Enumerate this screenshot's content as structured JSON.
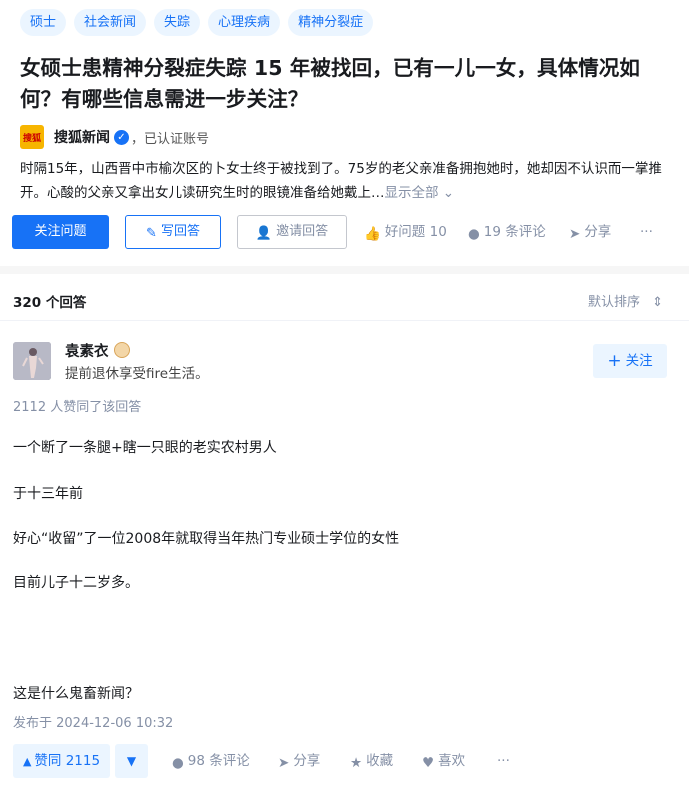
{
  "tags": [
    "硕士",
    "社会新闻",
    "失踪",
    "心理疾病",
    "精神分裂症"
  ],
  "question": {
    "title": "女硕士患精神分裂症失踪 15 年被找回，已有一儿一女，具体情况如何？有哪些信息需进一步关注？",
    "source_logo": "搜狐",
    "source_name": "搜狐新闻",
    "verified_text": "，已认证账号",
    "description": "时隔15年，山西晋中市榆次区的卜女士终于被找到了。75岁的老父亲准备拥抱她时，她却因不认识而一掌推开。心酸的父亲又拿出女儿读研究生时的眼镜准备给她戴上…",
    "show_all": "显示全部",
    "actions": {
      "follow": "关注问题",
      "write": "写回答",
      "invite": "邀请回答",
      "good_question": "好问题 10",
      "comments": "19 条评论",
      "share": "分享",
      "more": "···"
    }
  },
  "answers": {
    "count_label": "320 个回答",
    "sort_label": "默认排序",
    "item": {
      "author_name": "袁素衣",
      "author_bio": "提前退休享受fire生活。",
      "follow_label": "关注",
      "likes_text": "2112 人赞同了该回答",
      "paragraphs": [
        "一个断了一条腿+瞎一只眼的老实农村男人",
        "于十三年前",
        "好心“收留”了一位2008年就取得当年热门专业硕士学位的女性",
        "目前儿子十二岁多。",
        "这是什么鬼畜新闻？"
      ],
      "published": "发布于 2024-12-06 10:32",
      "actions": {
        "upvote": "赞同 2115",
        "downvote": "▼",
        "comments": "98 条评论",
        "share": "分享",
        "collect": "收藏",
        "like": "喜欢",
        "more": "···"
      }
    }
  },
  "colors": {
    "accent": "#1772f6",
    "accent_bg": "#ebf5ff",
    "muted": "#8590a6"
  }
}
